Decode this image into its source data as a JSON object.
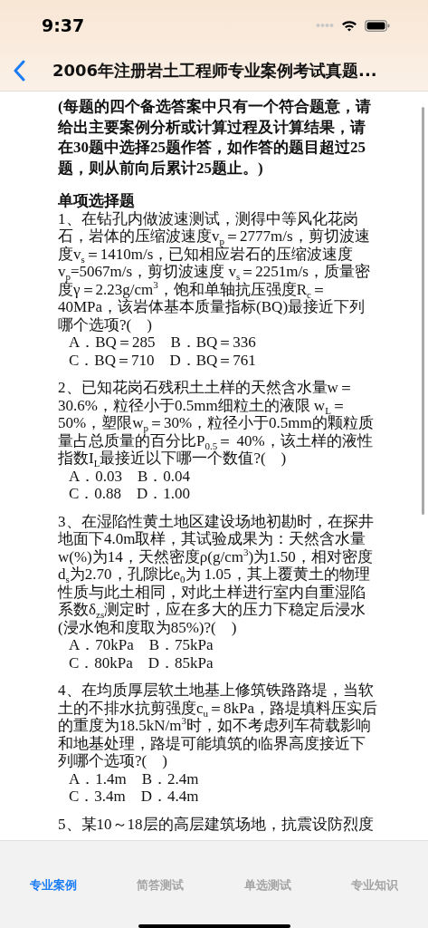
{
  "status_bar": {
    "time": "9:37"
  },
  "nav": {
    "title": "2006年注册岩土工程师专业案例考试真题..."
  },
  "note": "(每题的四个备选答案中只有一个符合题意，请给出主要案例分析或计算过程及计算结果，请在30题中选择25题作答，如作答的题目超过25题，则从前向后累计25题止。)",
  "section_heading": "单项选择题",
  "questions": [
    {
      "text": "1、在钻孔内做波速测试，测得中等风化花岗石，岩体的压缩波速度v$_{p}$＝2777m/s，剪切波速度v$_{s}$＝1410m/s，已知相应岩石的压缩波速度v$_{p}$=5067m/s，剪切波速度 v$_{s}$＝2251m/s，质量密度γ＝2.23g/cm$^{3}$，饱和单轴抗压强度R$_{c}$＝40MPa，该岩体基本质量指标(BQ)最接近下列哪个选项?(　)",
      "options": [
        "A．BQ＝285　B．BQ＝336",
        "C．BQ＝710　D．BQ＝761"
      ]
    },
    {
      "text": "2、已知花岗石残积土土样的天然含水量w＝30.6%，粒径小于0.5mm细粒土的液限 w$_{L}$＝50%，塑限w$_{p}$＝30%，粒径小于0.5mm的颗粒质量占总质量的百分比P$_{0.5}$＝ 40%，该土样的液性指数I$_{L}$最接近以下哪一个数值?(　)",
      "options": [
        "A．0.03　B．0.04",
        "C．0.88　D．1.00"
      ]
    },
    {
      "text": "3、在湿陷性黄土地区建设场地初勘时，在探井地面下4.0m取样，其试验成果为：天然含水量w(%)为14，天然密度ρ(g/cm$^{3}$)为1.50，相对密度d$_{s}$为2.70，孔隙比e$_{0}$为 1.05，其上覆黄土的物理性质与此土相同，对此土样进行室内自重湿陷系数δ$_{zs}$测定时，应在多大的压力下稳定后浸水(浸水饱和度取为85%)?(　)",
      "options": [
        "A．70kPa　B．75kPa",
        "C．80kPa　D．85kPa"
      ]
    },
    {
      "text": "4、在均质厚层软土地基上修筑铁路路堤，当软土的不排水抗剪强度c$_{u}$＝8kPa，路堤填料压实后的重度为18.5kN/m$^{3}$时，如不考虑列车荷载影响和地基处理，路堤可能填筑的临界高度接近下列哪个选项?(　)",
      "options": [
        "A．1.4m　B．2.4m",
        "C．3.4m　D．4.4m"
      ]
    },
    {
      "text": "5、某10～18层的高层建筑场地，抗震设防烈度"
    }
  ],
  "tabs": [
    {
      "label": "专业案例",
      "selected": true
    },
    {
      "label": "简答测试",
      "selected": false
    },
    {
      "label": "单选测试",
      "selected": false
    },
    {
      "label": "专业知识",
      "selected": false
    }
  ]
}
